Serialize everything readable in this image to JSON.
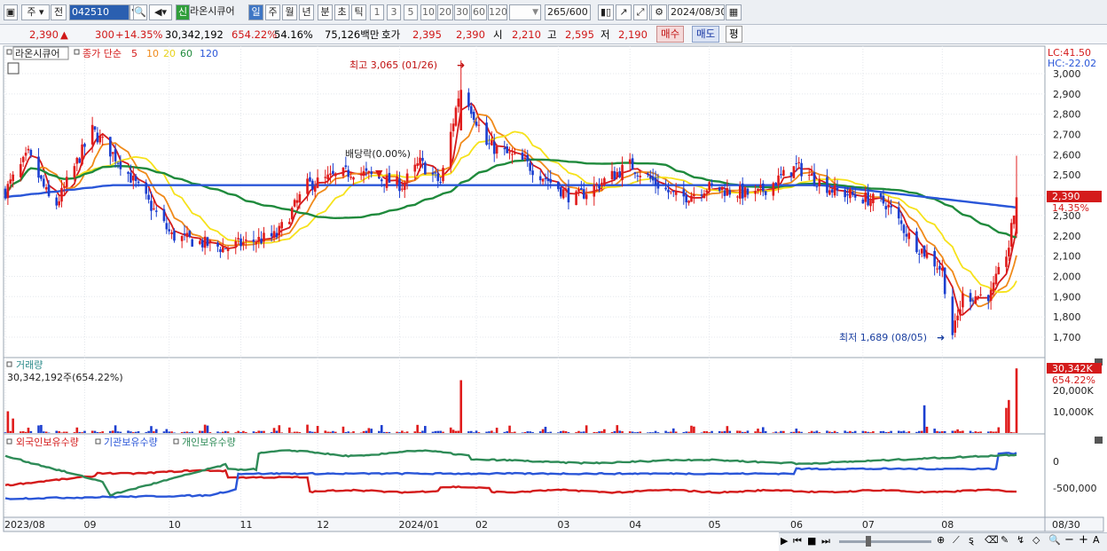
{
  "toolbar": {
    "market": "주",
    "prev_label": "전",
    "code": "042510",
    "stock_name": "라온시큐어",
    "new_badge": "신",
    "periods": [
      "일",
      "주",
      "월",
      "년",
      "분",
      "초",
      "틱"
    ],
    "active_period": "일",
    "numbers": [
      "1",
      "3",
      "5",
      "10",
      "20",
      "30",
      "60",
      "120"
    ],
    "count": "265",
    "count_total": "/600",
    "date": "2024/08/30"
  },
  "quote": {
    "price": "2,390",
    "change": "300",
    "change_pct": "+14.35%",
    "volume": "30,342,192",
    "volume_ratio": "654.22%",
    "turnover": "54.16%",
    "amount": "75,126백만",
    "ask_label": "호가",
    "ask": "2,395",
    "bid": "2,390",
    "open_label": "시",
    "open": "2,210",
    "high_label": "고",
    "high": "2,595",
    "low_label": "저",
    "low": "2,190",
    "buy_label": "매수",
    "sell_label": "매도",
    "avg_label": "평"
  },
  "price_panel": {
    "legend_name": "라온시큐어",
    "legend_type": "종가 단순",
    "ma_periods": [
      "5",
      "10",
      "20",
      "60",
      "120"
    ],
    "ma_colors": [
      "#d41b1b",
      "#f08a1a",
      "#f6e21b",
      "#1f8a3c",
      "#2a56d8"
    ],
    "lc": "LC:41.50",
    "hc": "HC:-22.02",
    "y_ticks": [
      "3,000",
      "2,900",
      "2,800",
      "2,700",
      "2,600",
      "2,500",
      "2,400",
      "2,300",
      "2,200",
      "2,100",
      "2,000",
      "1,900",
      "1,800",
      "1,700"
    ],
    "current_price": "2,390",
    "current_pct": "14.35%",
    "high_annotation": "최고 3,065 (01/26)",
    "low_annotation": "최저 1,689 (08/05)",
    "dividend_annotation": "배당락(0.00%)"
  },
  "volume_panel": {
    "title": "거래량",
    "value": "30,342,192주(654.22%)",
    "y_ticks": [
      "20,000K",
      "10,000K"
    ],
    "current": "30,342K",
    "current_pct": "654.22%"
  },
  "holdings_panel": {
    "legends": [
      "외국인보유수량",
      "기관보유수량",
      "개인보유수량"
    ],
    "colors": [
      "#d41b1b",
      "#2a56d8",
      "#2e8b57"
    ],
    "y_ticks": [
      "0",
      "-500,000"
    ]
  },
  "x_axis": {
    "labels": [
      "2023/08",
      "09",
      "10",
      "11",
      "12",
      "2024/01",
      "02",
      "03",
      "04",
      "05",
      "06",
      "07",
      "08"
    ],
    "end_label": "08/30"
  },
  "chart_data": {
    "type": "candlestick",
    "ylim": [
      1650,
      3080
    ],
    "anchors": [
      [
        "2023/08/01",
        2420
      ],
      [
        "2023/08/10",
        2600
      ],
      [
        "2023/08/20",
        2330
      ],
      [
        "2023/09/04",
        2720
      ],
      [
        "2023/09/15",
        2560
      ],
      [
        "2023/10/05",
        2200
      ],
      [
        "2023/10/25",
        2140
      ],
      [
        "2023/11/15",
        2200
      ],
      [
        "2023/11/27",
        2450
      ],
      [
        "2023/12/15",
        2520
      ],
      [
        "2024/01/03",
        2450
      ],
      [
        "2024/01/10",
        2560
      ],
      [
        "2024/01/18",
        2460
      ],
      [
        "2024/01/26",
        2950
      ],
      [
        "2024/02/05",
        2650
      ],
      [
        "2024/02/20",
        2560
      ],
      [
        "2024/03/10",
        2380
      ],
      [
        "2024/04/01",
        2550
      ],
      [
        "2024/04/20",
        2380
      ],
      [
        "2024/05/01",
        2440
      ],
      [
        "2024/05/20",
        2400
      ],
      [
        "2024/06/05",
        2540
      ],
      [
        "2024/06/20",
        2420
      ],
      [
        "2024/07/10",
        2360
      ],
      [
        "2024/07/20",
        2180
      ],
      [
        "2024/08/01",
        2030
      ],
      [
        "2024/08/05",
        1700
      ],
      [
        "2024/08/09",
        1900
      ],
      [
        "2024/08/20",
        1910
      ],
      [
        "2024/08/27",
        2150
      ],
      [
        "2024/08/30",
        2390
      ]
    ],
    "high": {
      "date": "2024/01/26",
      "value": 3065
    },
    "low": {
      "date": "2024/08/05",
      "value": 1689
    },
    "last": {
      "open": 2210,
      "high": 2595,
      "low": 2190,
      "close": 2390
    },
    "volume_spikes": [
      [
        "2023/08/02",
        10200
      ],
      [
        "2023/08/04",
        6800
      ],
      [
        "2024/01/26",
        24800
      ],
      [
        "2024/07/25",
        13000
      ],
      [
        "2024/08/26",
        11800
      ],
      [
        "2024/08/27",
        15500
      ],
      [
        "2024/08/30",
        30342
      ]
    ]
  }
}
